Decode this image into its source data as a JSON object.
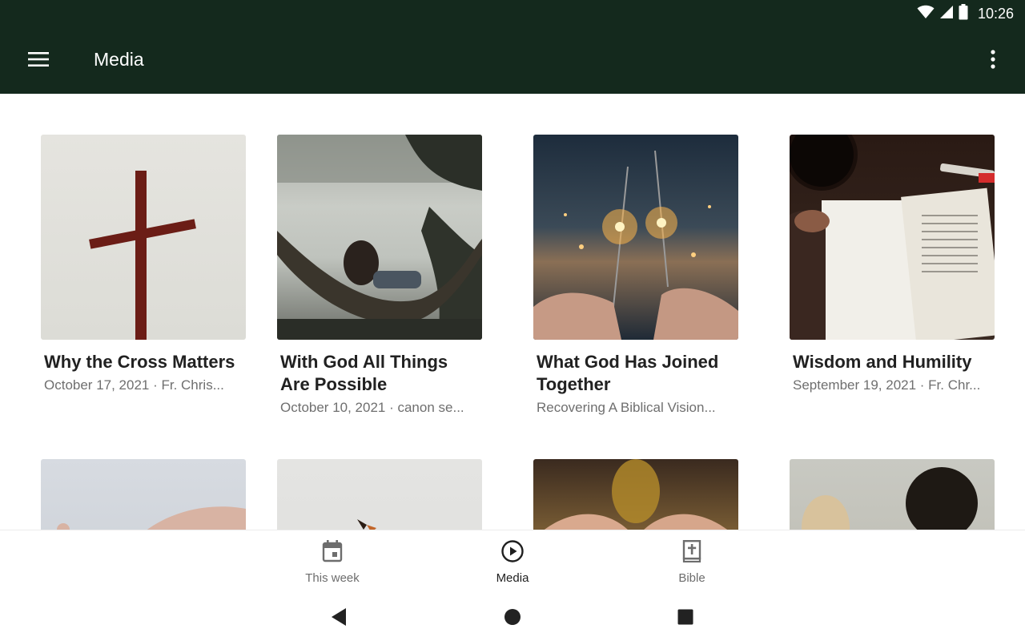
{
  "status_bar": {
    "time": "10:26"
  },
  "app_bar": {
    "title": "Media",
    "background_color": "#14291d"
  },
  "media_items": [
    {
      "title": "Why the Cross Matters",
      "subtitle": "October 17, 2021 · Fr. Chris..."
    },
    {
      "title": "With God All Things Are Possible",
      "subtitle": "October 10, 2021 · canon se..."
    },
    {
      "title": "What God Has Joined Together",
      "subtitle": "Recovering A Biblical Vision..."
    },
    {
      "title": "Wisdom and Humility",
      "subtitle": "September 19, 2021 · Fr. Chr..."
    },
    {
      "title": "",
      "subtitle": ""
    },
    {
      "title": "",
      "subtitle": ""
    },
    {
      "title": "",
      "subtitle": ""
    },
    {
      "title": "",
      "subtitle": ""
    }
  ],
  "bottom_nav": {
    "items": [
      {
        "label": "This week",
        "icon": "calendar-icon",
        "active": false
      },
      {
        "label": "Media",
        "icon": "play-circle-icon",
        "active": true
      },
      {
        "label": "Bible",
        "icon": "bible-icon",
        "active": false
      }
    ]
  },
  "system_nav": {
    "buttons": [
      "back",
      "home",
      "recents"
    ]
  }
}
